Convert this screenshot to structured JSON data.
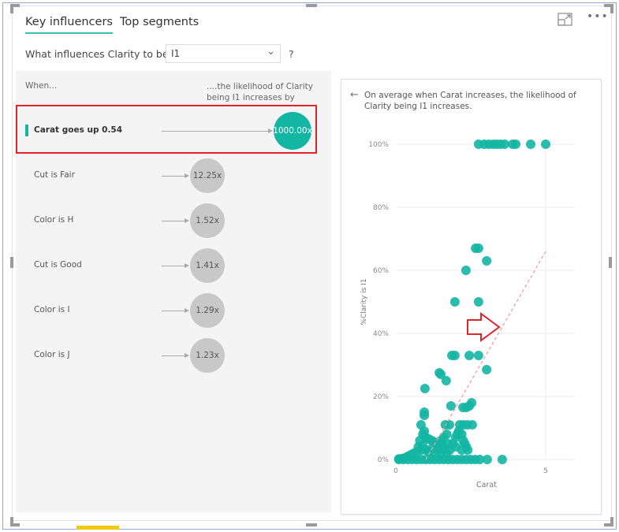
{
  "tabs": [
    {
      "label": "Key influencers",
      "active": true
    },
    {
      "label": "Top segments",
      "active": false
    }
  ],
  "question": {
    "label": "What influences Clarity to be",
    "selected": "I1",
    "help": "?"
  },
  "headers": {
    "when": "When...",
    "likelihood": "....the likelihood of Clarity being I1 increases by"
  },
  "influencers": [
    {
      "label": "Carat goes up 0.54",
      "value": "1000.00x",
      "selected": true
    },
    {
      "label": "Cut is Fair",
      "value": "12.25x"
    },
    {
      "label": "Color is H",
      "value": "1.52x"
    },
    {
      "label": "Cut is Good",
      "value": "1.41x"
    },
    {
      "label": "Color is I",
      "value": "1.29x"
    },
    {
      "label": "Color is J",
      "value": "1.23x"
    }
  ],
  "detail": {
    "description": "On average when Carat increases, the likelihood of Clarity being I1 increases."
  },
  "colors": {
    "accent": "#13b5a3",
    "bubble_grey": "#c8c8c8",
    "highlight_box": "#e0242c",
    "trend": "#f4a0a0"
  },
  "icons": {
    "back": "arrow-left-icon",
    "focus": "focus-mode-icon",
    "more": "more-options-icon"
  },
  "chart_data": {
    "type": "scatter",
    "xlabel": "Carat",
    "ylabel": "%Clarity is I1",
    "xlim": [
      0,
      6
    ],
    "ylim": [
      0,
      100
    ],
    "xticks": [
      "0",
      "5"
    ],
    "xtick_values": [
      0,
      5
    ],
    "yticks": [
      "0%",
      "20%",
      "40%",
      "60%",
      "80%",
      "100%"
    ],
    "ytick_values": [
      0,
      20,
      40,
      60,
      80,
      100
    ],
    "grid": true,
    "trendline": {
      "style": "dashed",
      "points": [
        [
          1.0,
          0
        ],
        [
          5.0,
          66
        ]
      ]
    },
    "points": [
      [
        2.76,
        100
      ],
      [
        2.95,
        100
      ],
      [
        3.1,
        100
      ],
      [
        3.25,
        100
      ],
      [
        3.37,
        100
      ],
      [
        3.5,
        100
      ],
      [
        3.63,
        100
      ],
      [
        3.9,
        100
      ],
      [
        4.0,
        100
      ],
      [
        4.5,
        100
      ],
      [
        5.0,
        100
      ],
      [
        2.66,
        67
      ],
      [
        2.76,
        67
      ],
      [
        3.03,
        63
      ],
      [
        2.34,
        60
      ],
      [
        1.97,
        50
      ],
      [
        2.76,
        50
      ],
      [
        1.87,
        33
      ],
      [
        1.97,
        33
      ],
      [
        2.45,
        33
      ],
      [
        2.76,
        33
      ],
      [
        3.03,
        28.5
      ],
      [
        1.45,
        27.5
      ],
      [
        1.5,
        27
      ],
      [
        1.68,
        25
      ],
      [
        0.97,
        22.5
      ],
      [
        1.84,
        17
      ],
      [
        2.24,
        16.5
      ],
      [
        2.35,
        16.5
      ],
      [
        2.45,
        17
      ],
      [
        2.53,
        18
      ],
      [
        0.95,
        15
      ],
      [
        0.95,
        14
      ],
      [
        0.84,
        11
      ],
      [
        1.65,
        11
      ],
      [
        1.79,
        11
      ],
      [
        2.13,
        11
      ],
      [
        2.25,
        11
      ],
      [
        2.39,
        11
      ],
      [
        2.55,
        11
      ],
      [
        0.9,
        8
      ],
      [
        0.95,
        9
      ],
      [
        1.0,
        7
      ],
      [
        1.1,
        6.5
      ],
      [
        1.2,
        6
      ],
      [
        1.3,
        5.5
      ],
      [
        1.4,
        5
      ],
      [
        1.5,
        6
      ],
      [
        1.55,
        4.5
      ],
      [
        1.6,
        7
      ],
      [
        1.7,
        8
      ],
      [
        1.75,
        5
      ],
      [
        1.8,
        3
      ],
      [
        2.0,
        7
      ],
      [
        2.05,
        8
      ],
      [
        2.1,
        9
      ],
      [
        2.2,
        8
      ],
      [
        2.25,
        6
      ],
      [
        2.3,
        5
      ],
      [
        2.35,
        4
      ],
      [
        2.4,
        3
      ],
      [
        2.2,
        3
      ],
      [
        2.0,
        4
      ],
      [
        1.9,
        5
      ],
      [
        0.8,
        6
      ],
      [
        0.75,
        4
      ],
      [
        0.85,
        3
      ],
      [
        0.9,
        4.5
      ],
      [
        1.0,
        3
      ],
      [
        1.1,
        2.5
      ],
      [
        1.2,
        3.5
      ],
      [
        1.3,
        2
      ],
      [
        1.4,
        3
      ],
      [
        1.5,
        2
      ],
      [
        1.6,
        3.5
      ],
      [
        1.7,
        2
      ],
      [
        0.6,
        2
      ],
      [
        0.5,
        1.5
      ],
      [
        0.4,
        1
      ],
      [
        0.7,
        2.5
      ],
      [
        0.3,
        0.5
      ],
      [
        0.2,
        0.3
      ],
      [
        0.1,
        0.2
      ],
      [
        0.1,
        0
      ],
      [
        0.25,
        0
      ],
      [
        0.4,
        0
      ],
      [
        0.55,
        0
      ],
      [
        0.7,
        0
      ],
      [
        0.85,
        0
      ],
      [
        1.0,
        0
      ],
      [
        1.15,
        0
      ],
      [
        1.3,
        0
      ],
      [
        1.45,
        0
      ],
      [
        1.6,
        0
      ],
      [
        1.75,
        0
      ],
      [
        1.9,
        0
      ],
      [
        2.05,
        0
      ],
      [
        2.2,
        0
      ],
      [
        2.35,
        0
      ],
      [
        2.5,
        0
      ],
      [
        2.65,
        0
      ],
      [
        2.8,
        0
      ],
      [
        3.05,
        0
      ],
      [
        3.55,
        0
      ]
    ]
  }
}
